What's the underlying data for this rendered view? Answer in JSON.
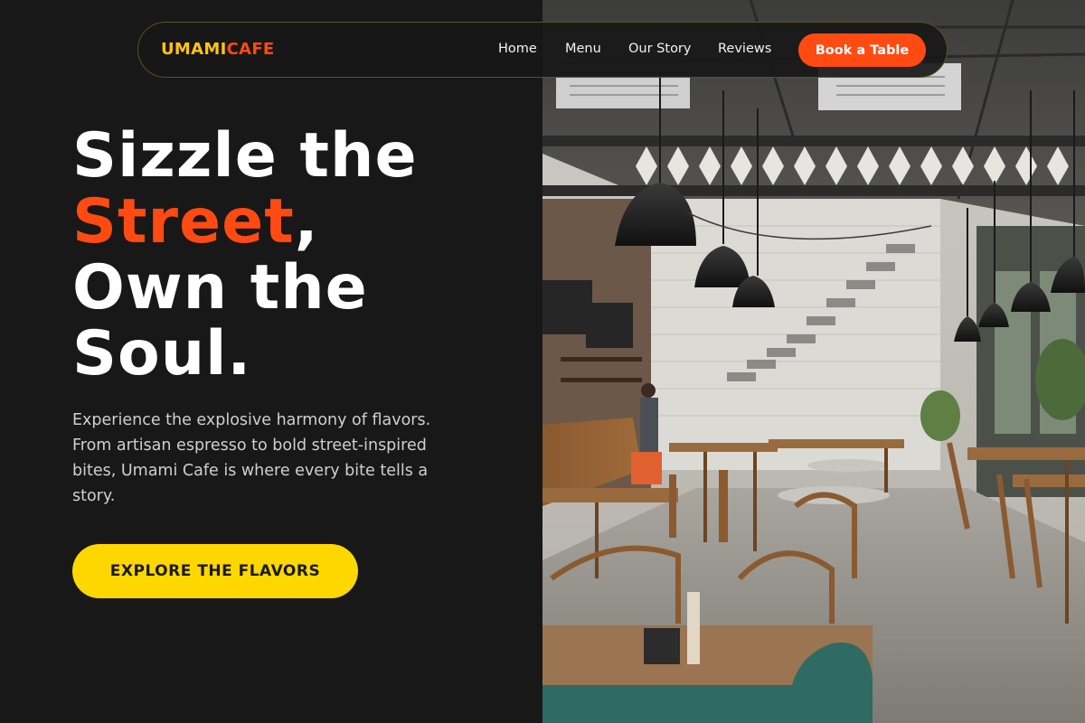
{
  "brand": {
    "logo_part1": "UMAMI",
    "logo_part2": "CAFE"
  },
  "nav": {
    "links": [
      "Home",
      "Menu",
      "Our Story",
      "Reviews"
    ],
    "book_label": "Book a Table"
  },
  "hero": {
    "headline_line1": "Sizzle the",
    "headline_accent": "Street",
    "headline_comma": ",",
    "headline_line3": "Own the",
    "headline_line4": "Soul.",
    "description": "Experience the explosive harmony of flavors. From artisan espresso to bold street-inspired bites, Umami Cafe is where every bite tells a story.",
    "cta_label": "EXPLORE THE FLAVORS"
  },
  "photo": {
    "subject": "industrial-cafe-interior"
  },
  "colors": {
    "background": "#181818",
    "accent_orange": "#ff4a12",
    "accent_yellow": "#ffd700",
    "logo_yellow": "#ffc510"
  }
}
